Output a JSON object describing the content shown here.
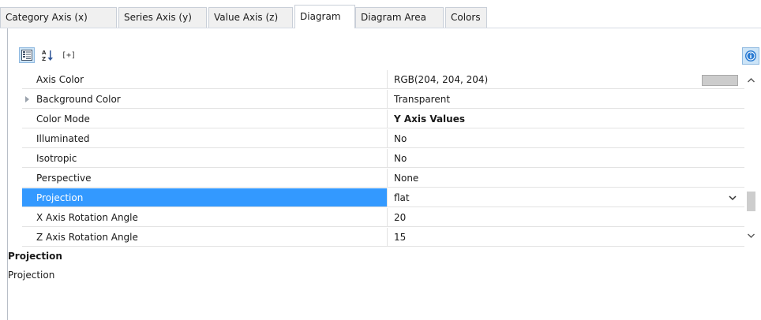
{
  "tabs": [
    {
      "label": "Category Axis (x)",
      "active": false
    },
    {
      "label": "Series Axis (y)",
      "active": false
    },
    {
      "label": "Value Axis (z)",
      "active": false
    },
    {
      "label": "Diagram",
      "active": true
    },
    {
      "label": "Diagram Area",
      "active": false
    },
    {
      "label": "Colors",
      "active": false
    }
  ],
  "toolbar": {
    "categorized_icon": "categorized-view-icon",
    "alphabetical_icon": "sort-alphabetical-icon",
    "expand_label": "[+]",
    "info_icon": "info-icon"
  },
  "properties": [
    {
      "name": "Axis Color",
      "value": "RGB(204, 204, 204)",
      "swatch": "#cccccc"
    },
    {
      "name": "Background Color",
      "value": "Transparent",
      "expandable": true
    },
    {
      "name": "Color Mode",
      "value": "Y Axis Values",
      "bold": true
    },
    {
      "name": "Illuminated",
      "value": "No"
    },
    {
      "name": "Isotropic",
      "value": "No"
    },
    {
      "name": "Perspective",
      "value": "None"
    },
    {
      "name": "Projection",
      "value": "flat",
      "selected": true,
      "dropdown": true
    },
    {
      "name": "X Axis Rotation Angle",
      "value": "20"
    },
    {
      "name": "Z Axis Rotation Angle",
      "value": "15"
    }
  ],
  "description": {
    "title": "Projection",
    "text": "Projection"
  },
  "colors": {
    "selection": "#3399ff",
    "swatch": "#cccccc",
    "toolbar_active": "#cce4f7",
    "info_icon": "#2b7cd3"
  }
}
